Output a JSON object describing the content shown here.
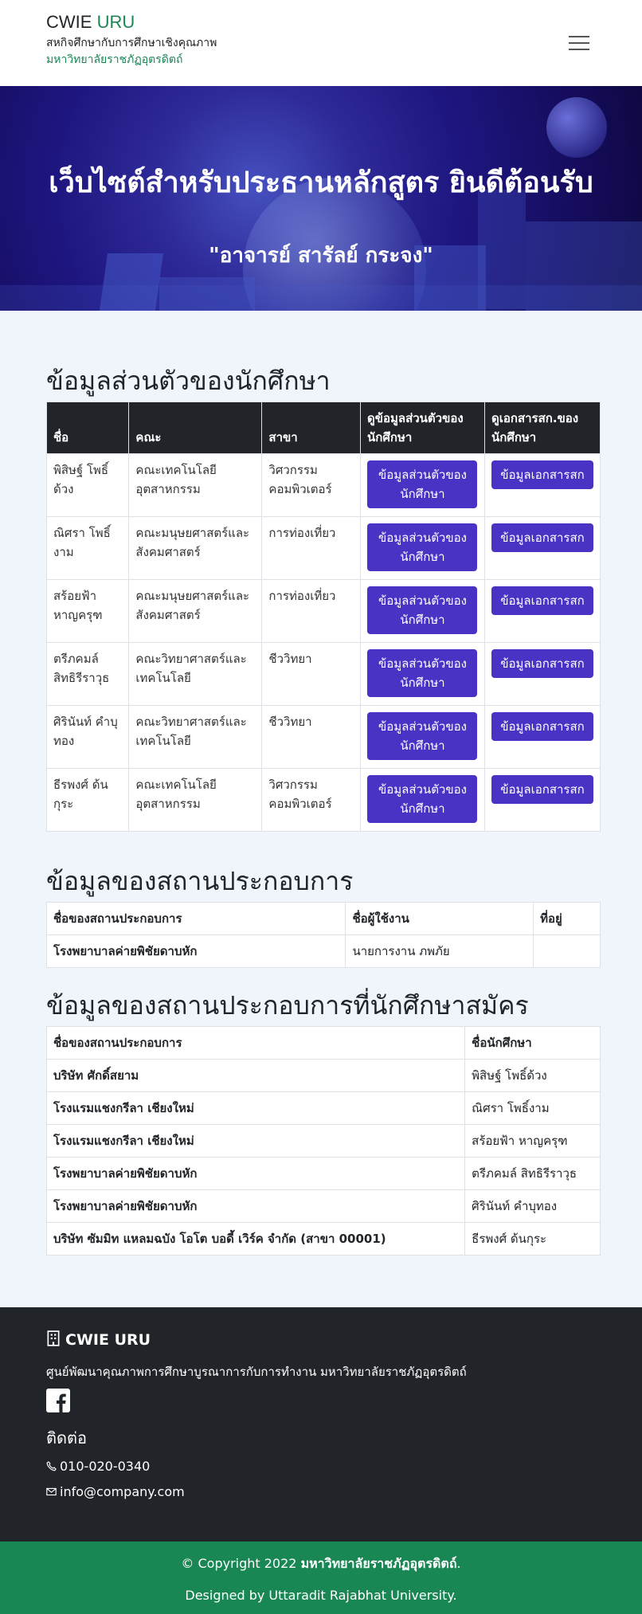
{
  "header": {
    "brand_prefix": "CWIE",
    "brand_accent": "URU",
    "subtitle": "สหกิจศึกษากับการศึกษาเชิงคุณภาพ",
    "university": "มหาวิทยาลัยราชภัฏอุตรดิตถ์"
  },
  "hero": {
    "title": "เว็บไซต์สำหรับประธานหลักสูตร ยินดีต้อนรับ",
    "name": "\"อาจารย์ สารัลย์ กระจง\""
  },
  "students_section": {
    "title": "ข้อมูลส่วนตัวของนักศึกษา",
    "headers": [
      "ชื่อ",
      "คณะ",
      "สาขา",
      "ดูข้อมูลส่วนตัวของนักศึกษา",
      "ดูเอกสารสก.ของนักศึกษา"
    ],
    "btn_profile": "ข้อมูลส่วนตัวของนักศึกษา",
    "btn_docs": "ข้อมูลเอกสารสก",
    "rows": [
      {
        "name": "พิสิษฐ์ โพธิ์ด้วง",
        "faculty": "คณะเทคโนโลยีอุตสาหกรรม",
        "major": "วิศวกรรมคอมพิวเตอร์"
      },
      {
        "name": "ณิศรา โพธิ์งาม",
        "faculty": "คณะมนุษยศาสตร์และสังคมศาสตร์",
        "major": "การท่องเที่ยว"
      },
      {
        "name": "สร้อยฟ้า หาญครุฑ",
        "faculty": "คณะมนุษยศาสตร์และสังคมศาสตร์",
        "major": "การท่องเที่ยว"
      },
      {
        "name": "ตรีภคมล์ สิทธิรีราวุธ",
        "faculty": "คณะวิทยาศาสตร์และเทคโนโลยี",
        "major": "ชีววิทยา"
      },
      {
        "name": "ศิรินันท์ คำบุทอง",
        "faculty": "คณะวิทยาศาสตร์และเทคโนโลยี",
        "major": "ชีววิทยา"
      },
      {
        "name": "ธีรพงศ์ ด้นกุระ",
        "faculty": "คณะเทคโนโลยีอุตสาหกรรม",
        "major": "วิศวกรรมคอมพิวเตอร์"
      }
    ]
  },
  "company_section": {
    "title": "ข้อมูลของสถานประกอบการ",
    "headers": [
      "ชื่อของสถานประกอบการ",
      "ชื่อผู้ใช้งาน",
      "ที่อยู่"
    ],
    "rows": [
      {
        "company": "โรงพยาบาลค่ายพิชัยดาบหัก",
        "user": "นายการงาน ภพภัย",
        "address": ""
      }
    ]
  },
  "applied_section": {
    "title": "ข้อมูลของสถานประกอบการที่นักศึกษาสมัคร",
    "headers": [
      "ชื่อของสถานประกอบการ",
      "ชื่อนักศึกษา"
    ],
    "rows": [
      {
        "company": "บริษัท ศักดิ์สยาม",
        "student": "พิสิษฐ์ โพธิ์ด้วง"
      },
      {
        "company": "โรงแรมแชงกรีลา เชียงใหม่",
        "student": "ณิศรา โพธิ์งาม"
      },
      {
        "company": "โรงแรมแชงกรีลา เชียงใหม่",
        "student": "สร้อยฟ้า หาญครุฑ"
      },
      {
        "company": "โรงพยาบาลค่ายพิชัยดาบหัก",
        "student": "ตรีภคมล์ สิทธิรีราวุธ"
      },
      {
        "company": "โรงพยาบาลค่ายพิชัยดาบหัก",
        "student": "ศิรินันท์ คำบุทอง"
      },
      {
        "company": "บริษัท ซัมมิท แหลมฉบัง โอโต บอดี้ เวิร์ค จำกัด (สาขา 00001)",
        "student": "ธีรพงศ์ ด้นกุระ"
      }
    ]
  },
  "footer": {
    "brand": "CWIE URU",
    "description": "ศูนย์พัฒนาคุณภาพการศึกษาบูรณาการกับการทำงาน มหาวิทยาลัยราชภัฏอุตรดิตถ์",
    "contact_title": "ติดต่อ",
    "phone": "010-020-0340",
    "email": "info@company.com"
  },
  "copyright": {
    "prefix": "© Copyright 2022",
    "org": "มหาวิทยาลัยราชภัฏอุตรดิตถ์",
    "suffix": ".",
    "designed_prefix": "Designed by",
    "designer": "Uttaradit Rajabhat University."
  },
  "colors": {
    "accent": "#198754",
    "button": "#4833c5",
    "dark": "#212529"
  }
}
